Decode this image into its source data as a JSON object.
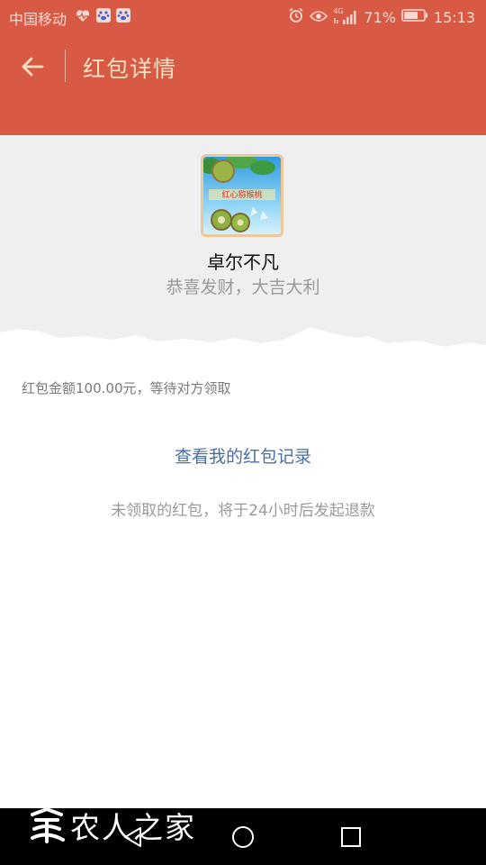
{
  "status_bar": {
    "carrier": "中国移动",
    "network": "4G",
    "battery": "71%",
    "time": "15:13"
  },
  "header": {
    "title": "红包详情"
  },
  "sender": {
    "name": "卓尔不凡",
    "greeting": "恭喜发财，大吉大利",
    "avatar_text": "红心猕猴桃"
  },
  "envelope": {
    "amount_status": "红包金额100.00元，等待对方领取",
    "records_link": "查看我的红包记录",
    "refund_note": "未领取的红包，将于24小时后发起退款"
  },
  "watermark": {
    "text": "农人之家"
  },
  "colors": {
    "header_red": "#D85A44",
    "title_gold": "#F7DFC2",
    "link_blue": "#4A6EA1",
    "gray_band": "#EFEFEF"
  },
  "icons": [
    "back-arrow-icon",
    "heart-rate-icon",
    "paw-icon",
    "alarm-icon",
    "eye-icon",
    "signal-icon",
    "battery-icon",
    "nav-back-icon",
    "nav-home-icon",
    "nav-recents-icon"
  ]
}
